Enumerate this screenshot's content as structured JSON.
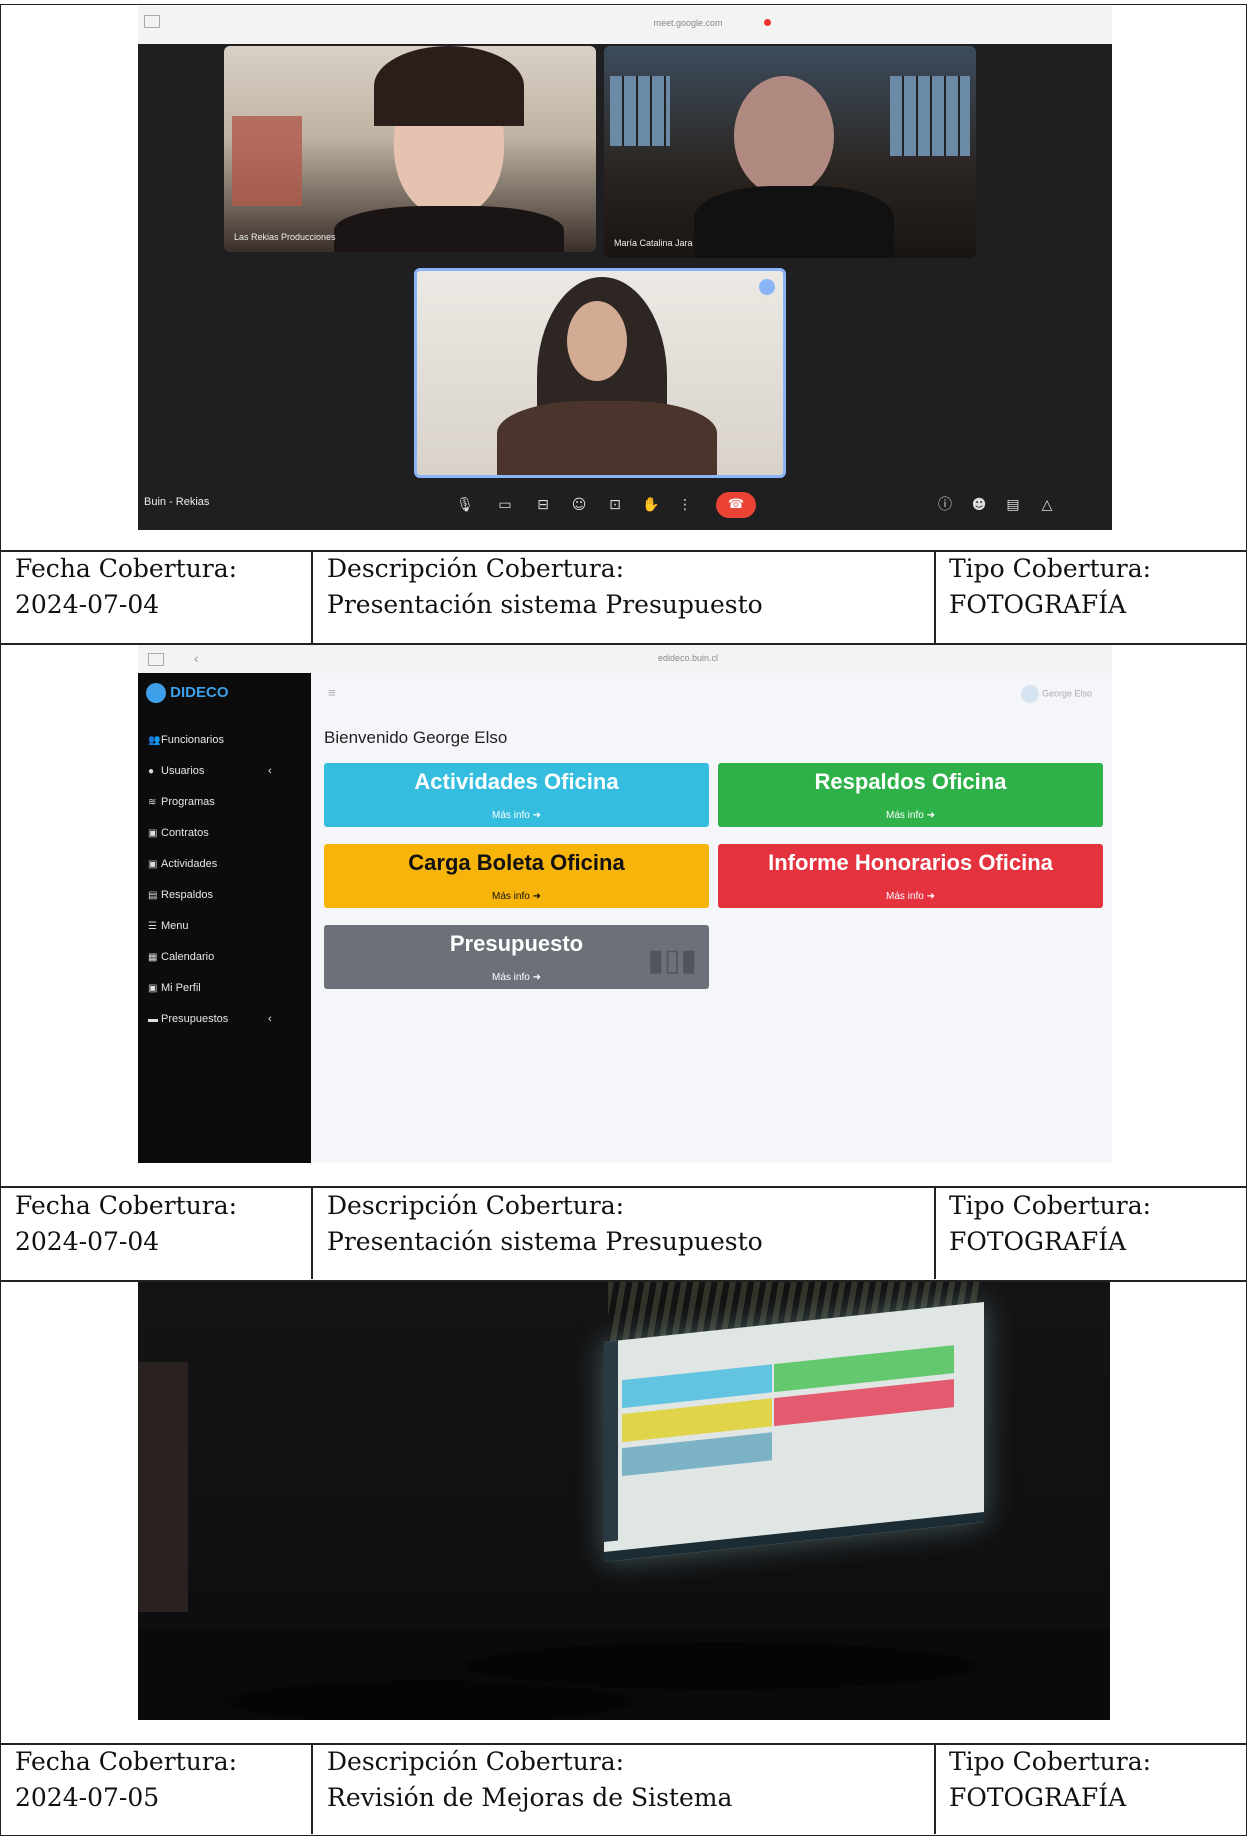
{
  "rows": [
    {
      "fecha_label": "Fecha Cobertura:",
      "fecha": "2024-07-04",
      "desc_label": "Descripción Cobertura:",
      "desc": "Presentación sistema Presupuesto",
      "tipo_label": "Tipo Cobertura:",
      "tipo": "FOTOGRAFÍA"
    },
    {
      "fecha_label": "Fecha Cobertura:",
      "fecha": "2024-07-04",
      "desc_label": "Descripción Cobertura:",
      "desc": "Presentación sistema Presupuesto",
      "tipo_label": "Tipo Cobertura:",
      "tipo": "FOTOGRAFÍA"
    },
    {
      "fecha_label": "Fecha Cobertura:",
      "fecha": "2024-07-05",
      "desc_label": "Descripción Cobertura:",
      "desc": "Revisión de Mejoras de Sistema",
      "tipo_label": "Tipo Cobertura:",
      "tipo": "FOTOGRAFÍA"
    }
  ],
  "meet": {
    "url": "meet.google.com",
    "participants": [
      "Las Rekias Producciones",
      "María Catalina Jara"
    ],
    "meeting_name": "Buin - Rekias"
  },
  "dideco": {
    "url": "edideco.buin.cl",
    "logo": "DIDECO",
    "user": "George Elso",
    "welcome": "Bienvenido George Elso",
    "menu": [
      "Funcionarios",
      "Usuarios",
      "Programas",
      "Contratos",
      "Actividades",
      "Respaldos",
      "Menu",
      "Calendario",
      "Mi Perfil",
      "Presupuestos"
    ],
    "boxes": [
      {
        "title": "Actividades Oficina",
        "more": "Más info",
        "color": "#35bde0"
      },
      {
        "title": "Respaldos Oficina",
        "more": "Más info",
        "color": "#2fb14a"
      },
      {
        "title": "Carga Boleta Oficina",
        "more": "Más info",
        "color": "#f7b50c"
      },
      {
        "title": "Informe Honorarios Oficina",
        "more": "Más info",
        "color": "#e5323f"
      },
      {
        "title": "Presupuesto",
        "more": "Más info",
        "color": "#6c7078"
      }
    ]
  }
}
